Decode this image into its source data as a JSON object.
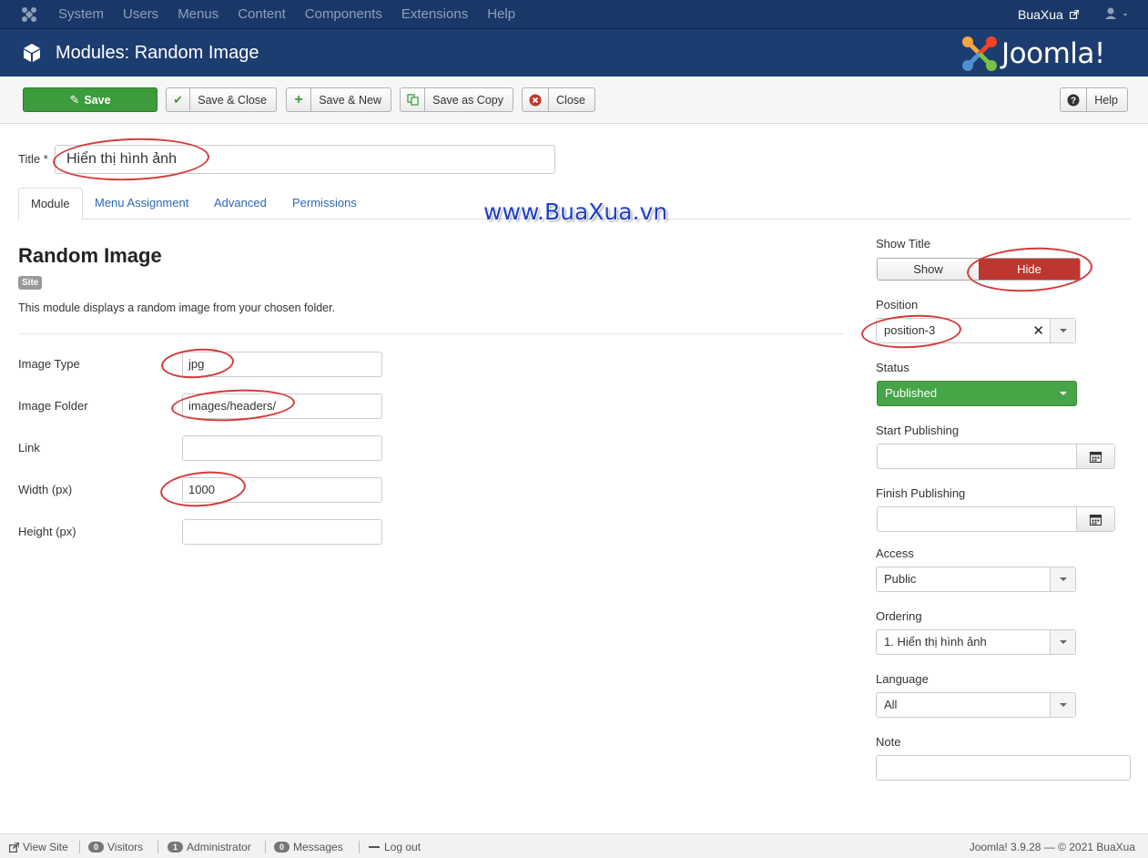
{
  "topbar": {
    "menu": [
      "System",
      "Users",
      "Menus",
      "Content",
      "Components",
      "Extensions",
      "Help"
    ],
    "site_name": "BuaXua"
  },
  "header": {
    "page_title": "Modules: Random Image",
    "brand": "Joomla!"
  },
  "toolbar": {
    "save": "Save",
    "save_close": "Save & Close",
    "save_new": "Save & New",
    "save_copy": "Save as Copy",
    "close": "Close",
    "help": "Help"
  },
  "title_field": {
    "label": "Title *",
    "value": "Hiển thị hình ảnh"
  },
  "tabs": [
    "Module",
    "Menu Assignment",
    "Advanced",
    "Permissions"
  ],
  "watermark": "www.BuaXua.vn",
  "module": {
    "heading": "Random Image",
    "badge": "Site",
    "description": "This module displays a random image from your chosen folder."
  },
  "fields": [
    {
      "label": "Image Type",
      "value": "jpg"
    },
    {
      "label": "Image Folder",
      "value": "images/headers/"
    },
    {
      "label": "Link",
      "value": ""
    },
    {
      "label": "Width (px)",
      "value": "1000"
    },
    {
      "label": "Height (px)",
      "value": ""
    }
  ],
  "sidebar": {
    "show_title": {
      "label": "Show Title",
      "show": "Show",
      "hide": "Hide",
      "selected": "Hide"
    },
    "position": {
      "label": "Position",
      "value": "position-3"
    },
    "status": {
      "label": "Status",
      "value": "Published"
    },
    "start_publishing": {
      "label": "Start Publishing",
      "value": ""
    },
    "finish_publishing": {
      "label": "Finish Publishing",
      "value": ""
    },
    "access": {
      "label": "Access",
      "value": "Public"
    },
    "ordering": {
      "label": "Ordering",
      "value": "1. Hiển thị hình ảnh"
    },
    "language": {
      "label": "Language",
      "value": "All"
    },
    "note": {
      "label": "Note",
      "value": ""
    }
  },
  "footer": {
    "view_site": "View Site",
    "visitors_count": "0",
    "visitors": "Visitors",
    "admin_count": "1",
    "admin": "Administrator",
    "messages_count": "0",
    "messages": "Messages",
    "logout": "Log out",
    "version": "Joomla! 3.9.28 — © 2021 BuaXua"
  },
  "colors": {
    "navbar": "#1a3867",
    "header": "#1c3d70",
    "save_green": "#3c9b3c",
    "hide_red": "#bd362f",
    "published_green": "#46a546",
    "link_blue": "#2a69b8",
    "annotation_red": "#d43a3a"
  }
}
